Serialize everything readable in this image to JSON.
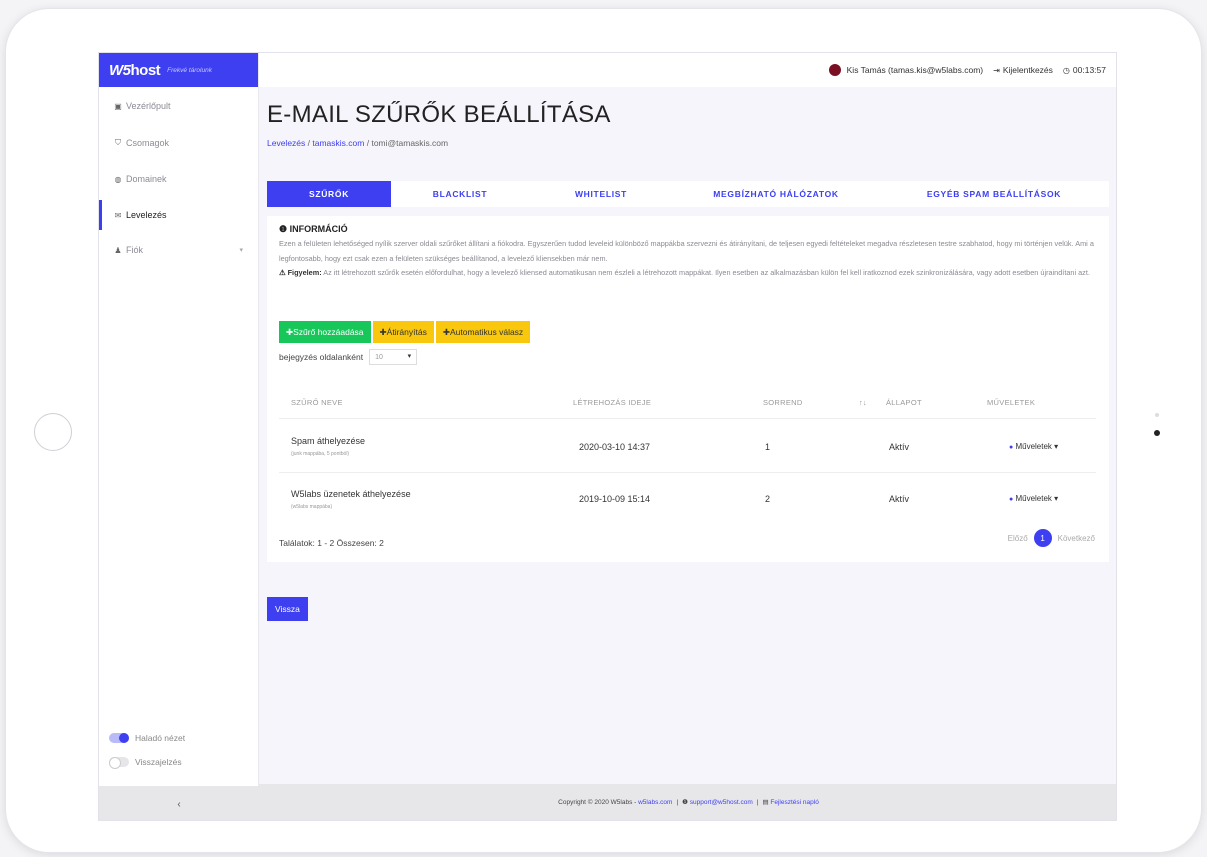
{
  "brand": {
    "logo_w5": "W5",
    "logo_host": "host",
    "tagline": "Frekvé tárolunk"
  },
  "sidebar": {
    "items": [
      {
        "icon": "dashboard-icon",
        "label": "Vezérlőpult"
      },
      {
        "icon": "shield-icon",
        "label": "Csomagok"
      },
      {
        "icon": "globe-icon",
        "label": "Domainek"
      },
      {
        "icon": "envelope-icon",
        "label": "Levelezés"
      },
      {
        "icon": "user-icon",
        "label": "Fiók"
      }
    ],
    "toggles": [
      {
        "label": "Haladó nézet",
        "on": true
      },
      {
        "label": "Visszajelzés",
        "on": false
      }
    ],
    "collapse_label": "‹"
  },
  "topbar": {
    "user": "Kis Tamás (tamas.kis@w5labs.com)",
    "logout": "Kijelentkezés",
    "timer": "00:13:57"
  },
  "page": {
    "title": "E-MAIL SZŰRŐK BEÁLLÍTÁSA",
    "breadcrumb": [
      "Levelezés",
      "tamaskis.com",
      "tomi@tamaskis.com"
    ]
  },
  "tabs": [
    {
      "label": "SZŰRŐK",
      "active": true
    },
    {
      "label": "BLACKLIST",
      "active": false
    },
    {
      "label": "WHITELIST",
      "active": false
    },
    {
      "label": "MEGBÍZHATÓ HÁLÓZATOK",
      "active": false
    },
    {
      "label": "EGYÉB SPAM BEÁLLÍTÁSOK",
      "active": false
    }
  ],
  "info": {
    "title": "INFORMÁCIÓ",
    "text": "Ezen a felületen lehetőséged nyílik szerver oldali szűrőket állítani a fiókodra. Egyszerűen tudod leveleid különböző mappákba szervezni és átirányítani, de teljesen egyedi feltételeket megadva részletesen testre szabhatod, hogy mi történjen velük. Ami a legfontosabb, hogy ezt csak ezen a felületen szükséges beállítanod, a levelező kliensekben már nem.",
    "warning_label": "Figyelem:",
    "warning_text": "Az itt létrehozott szűrők esetén előfordulhat, hogy a levelező kliensed automatikusan nem észleli a létrehozott mappákat. Ilyen esetben az alkalmazásban külön fel kell iratkoznod ezek szinkronizálására, vagy adott esetben újraindítani azt."
  },
  "buttons": {
    "add_filter": "Szűrő hozzáadása",
    "redirect": "Átirányítás",
    "auto_reply": "Automatikus válasz",
    "back": "Vissza"
  },
  "per_page": {
    "label": "bejegyzés oldalanként",
    "value": "10"
  },
  "table": {
    "headers": {
      "name": "SZŰRŐ NEVE",
      "created": "LÉTREHOZÁS IDEJE",
      "order": "SORREND",
      "sort": "↑↓",
      "status": "ÁLLAPOT",
      "actions": "MŰVELETEK"
    },
    "rows": [
      {
        "name": "Spam áthelyezése",
        "sub": "(junk mappába, 5 pontból)",
        "created": "2020-03-10 14:37",
        "order": "1",
        "status": "Aktív",
        "action": "Műveletek"
      },
      {
        "name": "W5labs üzenetek áthelyezése",
        "sub": "(w5labs mappába)",
        "created": "2019-10-09 15:14",
        "order": "2",
        "status": "Aktív",
        "action": "Műveletek"
      }
    ],
    "totals": "Találatok: 1 - 2 Összesen: 2"
  },
  "pagination": {
    "prev": "Előző",
    "current": "1",
    "next": "Következő"
  },
  "footer": {
    "copyright": "Copyright © 2020 W5labs -",
    "site": "w5labs.com",
    "support": "support@w5host.com",
    "changelog": "Fejlesztési napló"
  },
  "colors": {
    "accent": "#3d3ff0",
    "green": "#18c75a",
    "yellow": "#f9c80e"
  }
}
